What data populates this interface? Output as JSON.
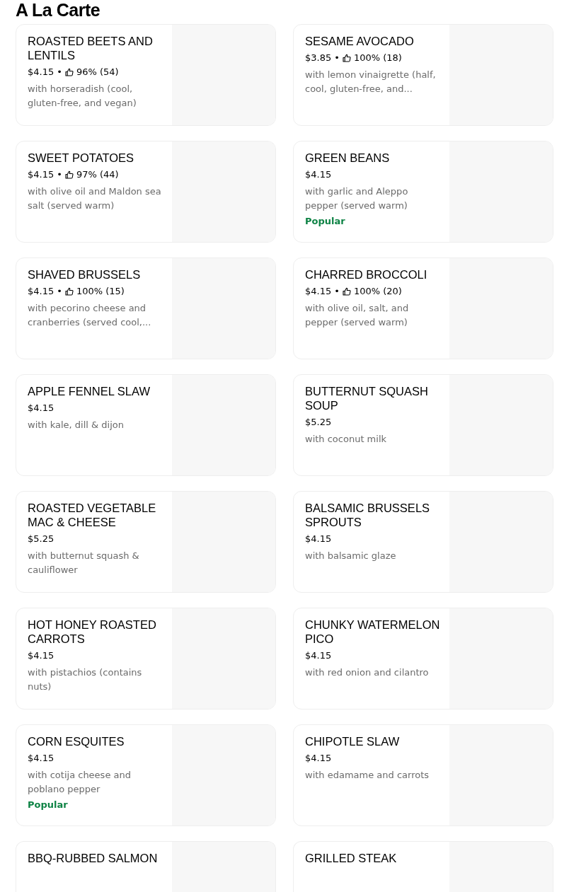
{
  "section": {
    "title": "A La Carte"
  },
  "items": [
    {
      "title": "ROASTED BEETS AND LENTILS",
      "price": "$4.15",
      "separator": "•",
      "rating": "96% (54)",
      "description": "with horseradish (cool, gluten-free, and vegan)"
    },
    {
      "title": "SESAME AVOCADO",
      "price": "$3.85",
      "separator": "•",
      "rating": "100% (18)",
      "description": "with lemon vinaigrette (half, cool, gluten-free, and..."
    },
    {
      "title": "SWEET POTATOES",
      "price": "$4.15",
      "separator": "•",
      "rating": "97% (44)",
      "description": "with olive oil and Maldon sea salt (served warm)"
    },
    {
      "title": "GREEN BEANS",
      "price": "$4.15",
      "description": "with garlic and Aleppo pepper (served warm)",
      "tag": "Popular"
    },
    {
      "title": "SHAVED BRUSSELS",
      "price": "$4.15",
      "separator": "•",
      "rating": "100% (15)",
      "description": "with pecorino cheese and cranberries (served cool,..."
    },
    {
      "title": "CHARRED BROCCOLI",
      "price": "$4.15",
      "separator": "•",
      "rating": "100% (20)",
      "description": "with olive oil, salt, and pepper (served warm)"
    },
    {
      "title": "APPLE FENNEL SLAW",
      "price": "$4.15",
      "description": "with kale, dill & dijon"
    },
    {
      "title": "BUTTERNUT SQUASH SOUP",
      "price": "$5.25",
      "description": "with coconut milk"
    },
    {
      "title": "ROASTED VEGETABLE MAC & CHEESE",
      "price": "$5.25",
      "description": "with butternut squash & cauliflower"
    },
    {
      "title": "BALSAMIC BRUSSELS SPROUTS",
      "price": "$4.15",
      "description": "with balsamic glaze"
    },
    {
      "title": "HOT HONEY ROASTED CARROTS",
      "price": "$4.15",
      "description": "with pistachios (contains nuts)"
    },
    {
      "title": "CHUNKY WATERMELON PICO",
      "price": "$4.15",
      "description": "with red onion and cilantro"
    },
    {
      "title": "CORN ESQUITES",
      "price": "$4.15",
      "description": "with cotija cheese and poblano pepper",
      "tag": "Popular"
    },
    {
      "title": "CHIPOTLE SLAW",
      "price": "$4.15",
      "description": "with edamame and carrots"
    },
    {
      "title": "BBQ-RUBBED SALMON"
    },
    {
      "title": "GRILLED STEAK"
    }
  ]
}
